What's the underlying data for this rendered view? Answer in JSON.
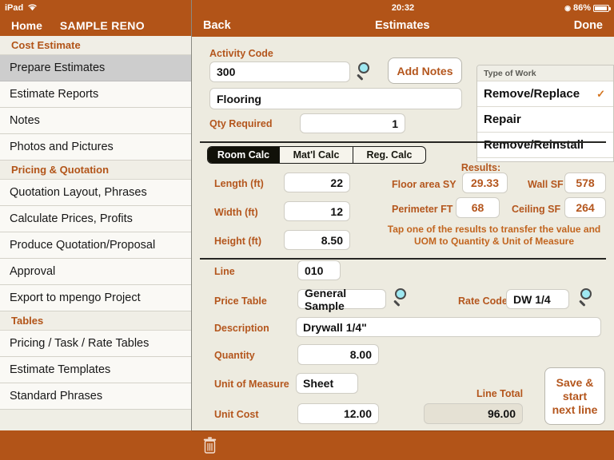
{
  "status": {
    "device": "iPad",
    "wifi_icon": "wifi-icon",
    "time": "20:32",
    "battery": "86%",
    "battery_icon": "battery-icon"
  },
  "sidebar": {
    "home_label": "Home",
    "project_label": "SAMPLE RENO",
    "sections": [
      {
        "header": "Cost Estimate",
        "items": [
          {
            "label": "Prepare Estimates",
            "selected": true
          },
          {
            "label": "Estimate Reports",
            "selected": false
          },
          {
            "label": "Notes",
            "selected": false
          },
          {
            "label": "Photos and Pictures",
            "selected": false
          }
        ]
      },
      {
        "header": "Pricing & Quotation",
        "items": [
          {
            "label": "Quotation Layout, Phrases",
            "selected": false
          },
          {
            "label": "Calculate Prices, Profits",
            "selected": false
          },
          {
            "label": "Produce Quotation/Proposal",
            "selected": false
          },
          {
            "label": "Approval",
            "selected": false
          },
          {
            "label": "Export to mpengo Project",
            "selected": false
          }
        ]
      },
      {
        "header": "Tables",
        "items": [
          {
            "label": "Pricing / Task / Rate Tables",
            "selected": false
          },
          {
            "label": "Estimate Templates",
            "selected": false
          },
          {
            "label": "Standard Phrases",
            "selected": false
          }
        ]
      }
    ]
  },
  "topbar": {
    "back_label": "Back",
    "title": "Estimates",
    "done_label": "Done"
  },
  "activity": {
    "code_label": "Activity Code",
    "code_value": "300",
    "search_icon": "search-icon",
    "add_notes_label": "Add Notes",
    "name_value": "Flooring",
    "qty_label": "Qty Required",
    "qty_value": "1"
  },
  "type_of_work": {
    "header": "Type of Work",
    "options": [
      {
        "label": "Remove/Replace",
        "checked": true
      },
      {
        "label": "Repair",
        "checked": false
      },
      {
        "label": "Remove/Reinstall",
        "checked": false
      }
    ],
    "check_glyph": "✓"
  },
  "calc": {
    "tabs": [
      {
        "label": "Room Calc",
        "selected": true
      },
      {
        "label": "Mat'l Calc",
        "selected": false
      },
      {
        "label": "Reg. Calc",
        "selected": false
      }
    ],
    "inputs": [
      {
        "label": "Length (ft)",
        "value": "22"
      },
      {
        "label": "Width (ft)",
        "value": "12"
      },
      {
        "label": "Height (ft)",
        "value": "8.50"
      }
    ],
    "results_title": "Results:",
    "results": [
      {
        "label": "Floor area SY",
        "value": "29.33"
      },
      {
        "label": "Wall SF",
        "value": "578"
      },
      {
        "label": "Perimeter FT",
        "value": "68"
      },
      {
        "label": "Ceiling SF",
        "value": "264"
      }
    ],
    "hint_line1": "Tap one of the results to transfer the value and",
    "hint_line2": "UOM to Quantity & Unit of Measure"
  },
  "line": {
    "line_label": "Line",
    "line_value": "010",
    "price_table_label": "Price Table",
    "price_table_value": "General Sample",
    "price_table_search_icon": "search-icon",
    "rate_code_label": "Rate Code",
    "rate_code_value": "DW 1/4",
    "rate_code_search_icon": "search-icon",
    "description_label": "Description",
    "description_value": "Drywall 1/4\"",
    "quantity_label": "Quantity",
    "quantity_value": "8.00",
    "uom_label": "Unit of Measure",
    "uom_value": "Sheet",
    "unit_cost_label": "Unit Cost",
    "unit_cost_value": "12.00",
    "line_total_label": "Line Total",
    "line_total_value": "96.00",
    "save_button_label": "Save &\nstart\nnext line"
  },
  "bottom": {
    "trash_icon": "trash-icon"
  },
  "colors": {
    "accent": "#B25418",
    "label": "#B4561D",
    "bg": "#EDEBE0",
    "selected_row": "#CDCDCD"
  }
}
